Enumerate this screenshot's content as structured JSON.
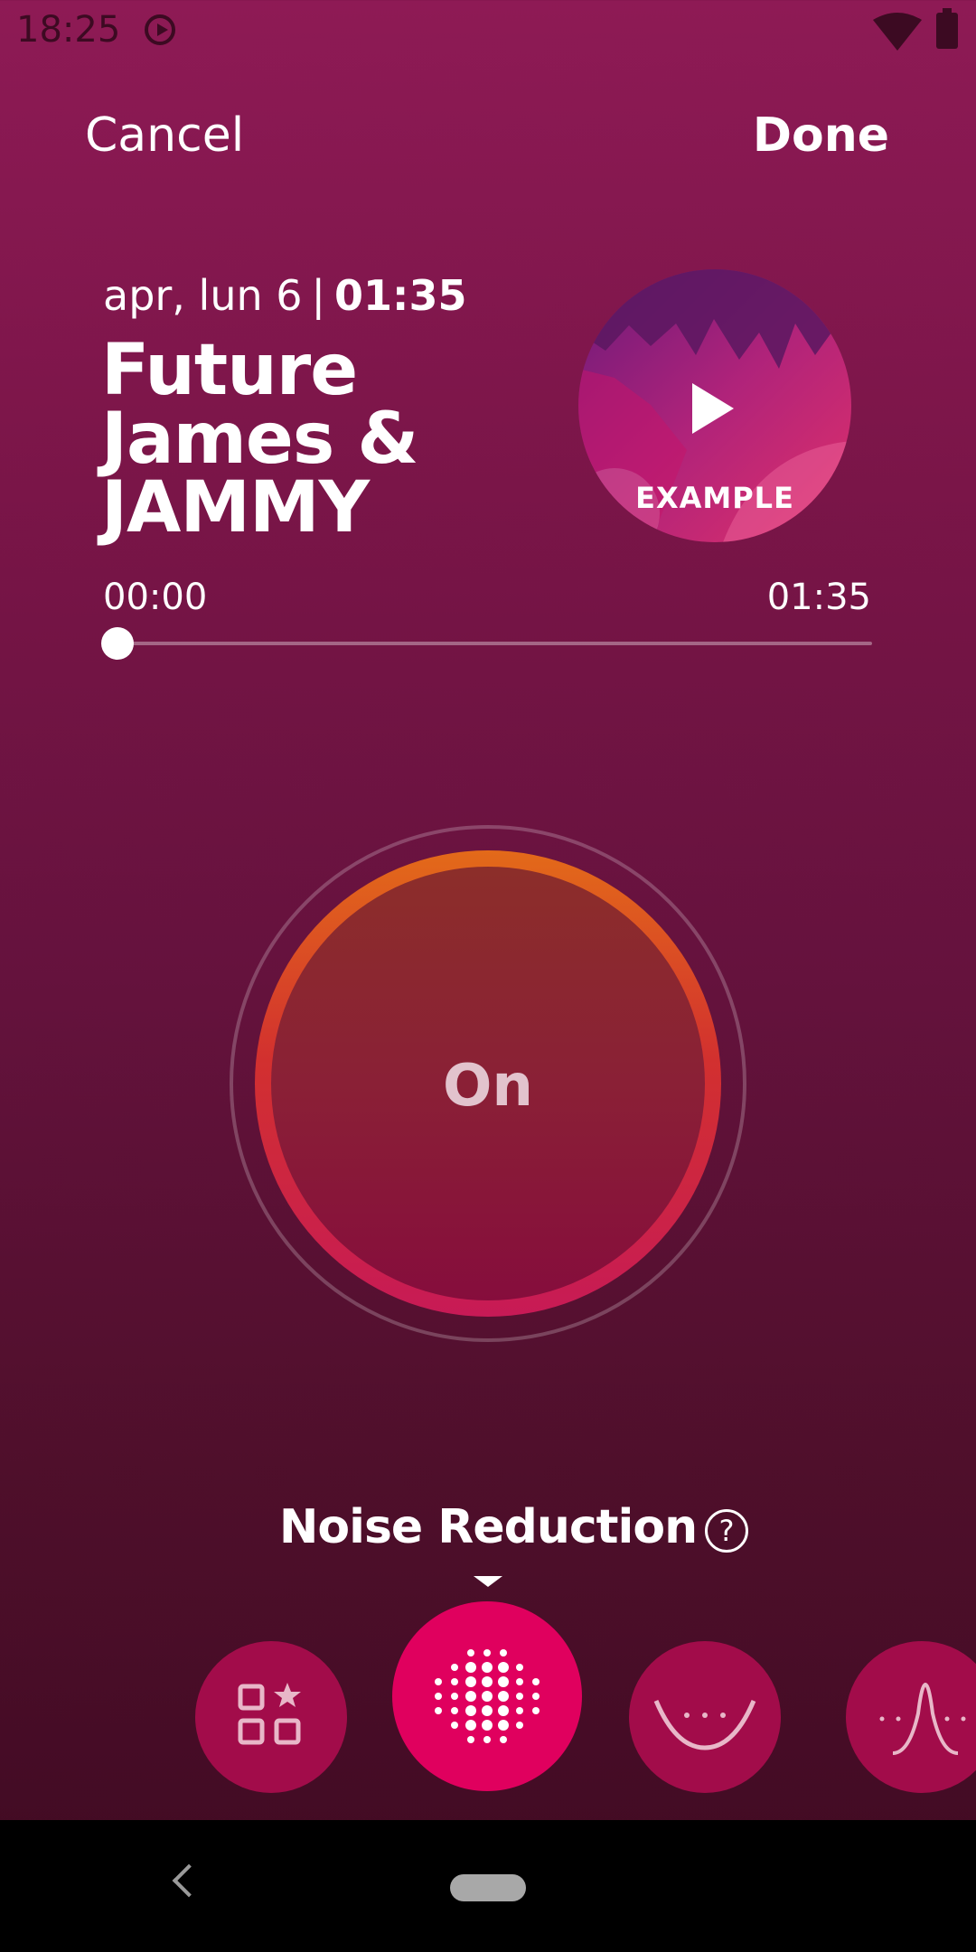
{
  "status_bar": {
    "time": "18:25"
  },
  "header": {
    "cancel_label": "Cancel",
    "done_label": "Done"
  },
  "recording": {
    "date": "apr, lun 6",
    "separator": "|",
    "duration": "01:35",
    "title": "Future James & JAMMY",
    "thumbnail_label": "EXAMPLE"
  },
  "player": {
    "current_time": "00:00",
    "total_time": "01:35",
    "progress": 0
  },
  "toggle": {
    "label": "On"
  },
  "mode": {
    "label": "Noise Reduction",
    "help_symbol": "?",
    "buttons": [
      {
        "icon": "presets-icon",
        "active": false
      },
      {
        "icon": "noise-reduction-icon",
        "active": true
      },
      {
        "icon": "low-cut-icon",
        "active": false
      },
      {
        "icon": "peak-filter-icon",
        "active": false
      }
    ]
  },
  "colors": {
    "accent": "#e0005e",
    "button": "#a20c4a",
    "ring_top": "#e36a19",
    "ring_bottom": "#c71a56"
  }
}
